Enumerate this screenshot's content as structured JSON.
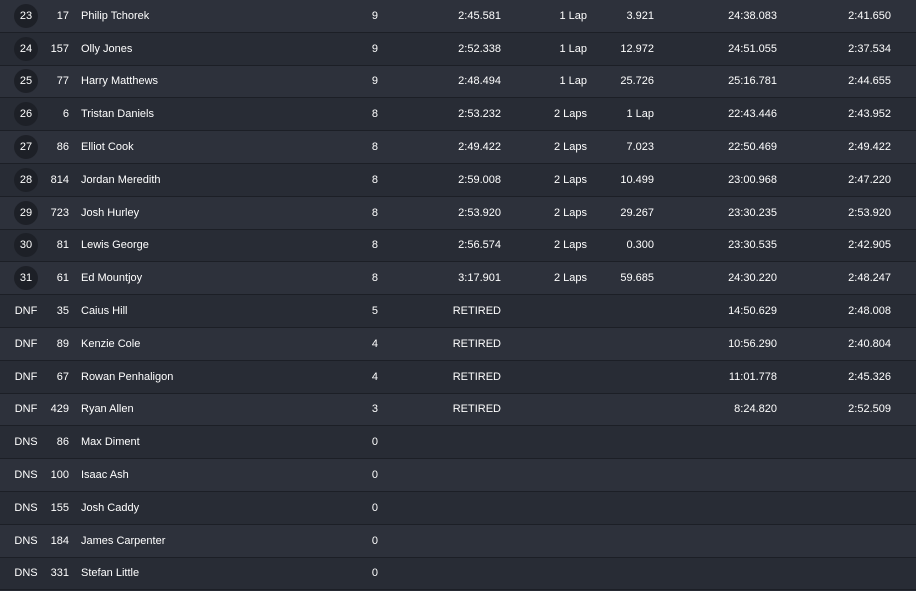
{
  "rows": [
    {
      "pos": "23",
      "num": "17",
      "name": "Philip Tchorek",
      "laps": "9",
      "best": "2:45.581",
      "gap": "1 Lap",
      "diff": "3.921",
      "total": "24:38.083",
      "fast": "2:41.650"
    },
    {
      "pos": "24",
      "num": "157",
      "name": "Olly Jones",
      "laps": "9",
      "best": "2:52.338",
      "gap": "1 Lap",
      "diff": "12.972",
      "total": "24:51.055",
      "fast": "2:37.534"
    },
    {
      "pos": "25",
      "num": "77",
      "name": "Harry Matthews",
      "laps": "9",
      "best": "2:48.494",
      "gap": "1 Lap",
      "diff": "25.726",
      "total": "25:16.781",
      "fast": "2:44.655"
    },
    {
      "pos": "26",
      "num": "6",
      "name": "Tristan Daniels",
      "laps": "8",
      "best": "2:53.232",
      "gap": "2 Laps",
      "diff": "1 Lap",
      "total": "22:43.446",
      "fast": "2:43.952"
    },
    {
      "pos": "27",
      "num": "86",
      "name": "Elliot Cook",
      "laps": "8",
      "best": "2:49.422",
      "gap": "2 Laps",
      "diff": "7.023",
      "total": "22:50.469",
      "fast": "2:49.422"
    },
    {
      "pos": "28",
      "num": "814",
      "name": "Jordan Meredith",
      "laps": "8",
      "best": "2:59.008",
      "gap": "2 Laps",
      "diff": "10.499",
      "total": "23:00.968",
      "fast": "2:47.220"
    },
    {
      "pos": "29",
      "num": "723",
      "name": "Josh Hurley",
      "laps": "8",
      "best": "2:53.920",
      "gap": "2 Laps",
      "diff": "29.267",
      "total": "23:30.235",
      "fast": "2:53.920"
    },
    {
      "pos": "30",
      "num": "81",
      "name": "Lewis George",
      "laps": "8",
      "best": "2:56.574",
      "gap": "2 Laps",
      "diff": "0.300",
      "total": "23:30.535",
      "fast": "2:42.905"
    },
    {
      "pos": "31",
      "num": "61",
      "name": "Ed Mountjoy",
      "laps": "8",
      "best": "3:17.901",
      "gap": "2 Laps",
      "diff": "59.685",
      "total": "24:30.220",
      "fast": "2:48.247"
    },
    {
      "pos": "DNF",
      "num": "35",
      "name": "Caius Hill",
      "laps": "5",
      "best": "RETIRED",
      "gap": "",
      "diff": "",
      "total": "14:50.629",
      "fast": "2:48.008"
    },
    {
      "pos": "DNF",
      "num": "89",
      "name": "Kenzie Cole",
      "laps": "4",
      "best": "RETIRED",
      "gap": "",
      "diff": "",
      "total": "10:56.290",
      "fast": "2:40.804"
    },
    {
      "pos": "DNF",
      "num": "67",
      "name": "Rowan Penhaligon",
      "laps": "4",
      "best": "RETIRED",
      "gap": "",
      "diff": "",
      "total": "11:01.778",
      "fast": "2:45.326"
    },
    {
      "pos": "DNF",
      "num": "429",
      "name": "Ryan Allen",
      "laps": "3",
      "best": "RETIRED",
      "gap": "",
      "diff": "",
      "total": "8:24.820",
      "fast": "2:52.509"
    },
    {
      "pos": "DNS",
      "num": "86",
      "name": "Max Diment",
      "laps": "0",
      "best": "",
      "gap": "",
      "diff": "",
      "total": "",
      "fast": ""
    },
    {
      "pos": "DNS",
      "num": "100",
      "name": "Isaac Ash",
      "laps": "0",
      "best": "",
      "gap": "",
      "diff": "",
      "total": "",
      "fast": ""
    },
    {
      "pos": "DNS",
      "num": "155",
      "name": "Josh Caddy",
      "laps": "0",
      "best": "",
      "gap": "",
      "diff": "",
      "total": "",
      "fast": ""
    },
    {
      "pos": "DNS",
      "num": "184",
      "name": "James Carpenter",
      "laps": "0",
      "best": "",
      "gap": "",
      "diff": "",
      "total": "",
      "fast": ""
    },
    {
      "pos": "DNS",
      "num": "331",
      "name": "Stefan Little",
      "laps": "0",
      "best": "",
      "gap": "",
      "diff": "",
      "total": "",
      "fast": ""
    }
  ]
}
